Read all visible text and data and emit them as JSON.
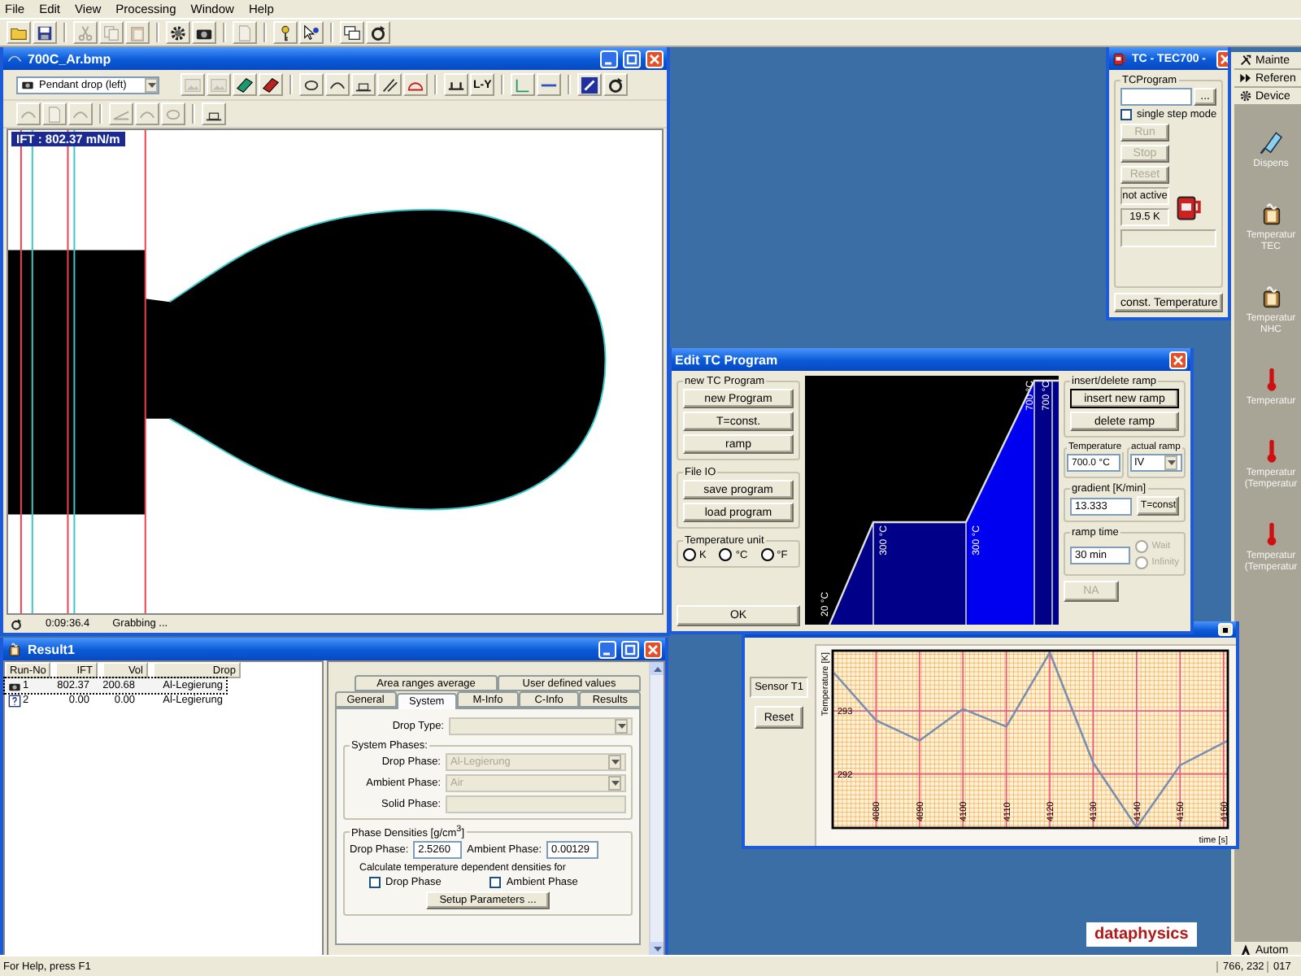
{
  "menu": [
    "File",
    "Edit",
    "View",
    "Processing",
    "Window",
    "Help"
  ],
  "toolbar": [
    {
      "kind": "open",
      "disabled": false
    },
    {
      "kind": "save",
      "disabled": false
    },
    {
      "kind": "cut",
      "disabled": true
    },
    {
      "kind": "copy",
      "disabled": true
    },
    {
      "kind": "paste",
      "disabled": true
    },
    {
      "kind": "gear",
      "disabled": false
    },
    {
      "kind": "camera",
      "disabled": false
    },
    {
      "kind": "document",
      "disabled": true
    },
    {
      "kind": "help",
      "disabled": false
    },
    {
      "kind": "context_help",
      "disabled": false
    },
    {
      "kind": "windows",
      "disabled": false
    },
    {
      "kind": "refresh",
      "disabled": false
    }
  ],
  "drop_window": {
    "title": "700C_Ar.bmp",
    "mode": "Pendant drop (left)",
    "tools_row_1": [
      {
        "kind": "image",
        "disabled": true
      },
      {
        "kind": "image",
        "disabled": true
      },
      {
        "kind": "film_green",
        "disabled": false
      },
      {
        "kind": "film_red",
        "disabled": false
      },
      {
        "kind": "ellipse",
        "disabled": false
      },
      {
        "kind": "arc",
        "disabled": false
      },
      {
        "kind": "baseline",
        "disabled": false
      },
      {
        "kind": "needle",
        "disabled": false
      },
      {
        "kind": "protractor",
        "disabled": false
      },
      {
        "kind": "bracket",
        "disabled": false
      },
      {
        "kind": "text",
        "label": "L-Y",
        "disabled": false
      },
      {
        "kind": "corner",
        "disabled": false
      },
      {
        "kind": "line",
        "disabled": false
      },
      {
        "kind": "pen",
        "disabled": false
      },
      {
        "kind": "refresh",
        "disabled": false
      }
    ],
    "tools_row_2": [
      {
        "kind": "arc",
        "disabled": true
      },
      {
        "kind": "document",
        "disabled": true
      },
      {
        "kind": "arc",
        "disabled": true
      },
      {
        "kind": "tilt",
        "disabled": true
      },
      {
        "kind": "arc",
        "disabled": true
      },
      {
        "kind": "ellipse",
        "disabled": true
      },
      {
        "kind": "baseline",
        "disabled": false
      }
    ],
    "measurement": "IFT : 802.37 mN/m",
    "elapsed": "0:09:36.4",
    "state": "Grabbing ..."
  },
  "result_window": {
    "title": "Result1",
    "columns": [
      "Run-No",
      "IFT",
      "Vol",
      "Drop"
    ],
    "rows": [
      {
        "kind": "camera",
        "run": "1",
        "ift": "802.37",
        "vol": "200.68",
        "drop": "Al-Legierung",
        "selected": true
      },
      {
        "kind": "unknown",
        "run": "2",
        "ift": "0.00",
        "vol": "0.00",
        "drop": "Al-Legierung",
        "selected": false
      }
    ],
    "tabs_row_1": [
      {
        "label": "Area ranges average",
        "selected": false
      },
      {
        "label": "User defined values",
        "selected": false
      }
    ],
    "tabs_row_2": [
      {
        "label": "General",
        "selected": false
      },
      {
        "label": "System",
        "selected": true
      },
      {
        "label": "M-Info",
        "selected": false
      },
      {
        "label": "C-Info",
        "selected": false
      },
      {
        "label": "Results",
        "selected": false
      }
    ],
    "drop_type": {
      "label": "Drop Type:"
    },
    "system_phases": {
      "title": "System Phases:",
      "fields": [
        {
          "kind": "select",
          "label": "Drop Phase:",
          "value": "Al-Legierung"
        },
        {
          "kind": "select",
          "label": "Ambient Phase:",
          "value": "Air"
        },
        {
          "kind": "text",
          "label": "Solid Phase:"
        }
      ]
    },
    "densities": {
      "title": "Phase Densities [g/cm$^{3}$]",
      "drop_label": "Drop Phase:",
      "drop_value": "2.5260",
      "ambient_label": "Ambient Phase:",
      "ambient_value": "0.00129",
      "note": "Calculate temperature dependent densities for",
      "checks": [
        {
          "label": "Drop Phase",
          "checked": false
        },
        {
          "label": "Ambient Phase",
          "checked": false
        }
      ],
      "setup": "Setup Parameters ..."
    }
  },
  "tc_window": {
    "title": "TC - TEC700 -",
    "group": "TCProgram",
    "browse": "...",
    "single_step": {
      "label": "single step mode",
      "checked": false
    },
    "buttons": [
      {
        "label": "Run",
        "disabled": true
      },
      {
        "label": "Stop",
        "disabled": true
      },
      {
        "label": "Reset",
        "disabled": true
      }
    ],
    "status": "not active",
    "reading": "19.5 K",
    "mode": "const. Temperature"
  },
  "edit_tc_window": {
    "title": "Edit TC Program",
    "new_group": {
      "title": "new TC Program",
      "buttons": [
        "new Program",
        "T=const.",
        "ramp"
      ]
    },
    "file_group": {
      "title": "File IO",
      "buttons": [
        "save program",
        "load program"
      ]
    },
    "unit_group": {
      "title": "Temperature unit",
      "options": [
        {
          "label": "K",
          "selected": false
        },
        {
          "label": "°C",
          "selected": false
        },
        {
          "label": "°F",
          "selected": false
        }
      ]
    },
    "ok": "OK",
    "profile_labels": [
      "20 °C",
      "300 °C",
      "300 °C",
      "700 °C",
      "700 °C"
    ],
    "ramp_group": {
      "title": "insert/delete ramp",
      "buttons": [
        "insert new ramp",
        "delete ramp"
      ]
    },
    "temperature": {
      "label": "Temperature",
      "value": "700.0 °C"
    },
    "actual_ramp": {
      "label": "actual ramp",
      "value": "IV"
    },
    "gradient": {
      "label": "gradient [K/min]",
      "value": "13.333",
      "button": "T=const"
    },
    "ramp_time": {
      "label": "ramp time",
      "value": "30 min",
      "options": [
        {
          "label": "Wait",
          "selected": false,
          "disabled": true
        },
        {
          "label": "Infinity",
          "selected": false,
          "disabled": true
        }
      ]
    },
    "na": "NA"
  },
  "sensor_window": {
    "sensor": "Sensor T1",
    "reset": "Reset",
    "chart_data": {
      "type": "line",
      "xlabel": "time [s]",
      "ylabel": "Temperature [K]",
      "x": [
        4070.3,
        4080,
        4090,
        4100,
        4110,
        4120,
        4130,
        4140,
        4150,
        4161
      ],
      "series": [
        {
          "color": "#7890b0",
          "values": [
            293.6,
            292.85,
            292.53,
            293.03,
            292.75,
            293.92,
            292.18,
            291.16,
            292.14,
            292.53
          ]
        }
      ],
      "grid": true,
      "xlim": [
        4070,
        4161
      ],
      "ylim": [
        291.15,
        293.95
      ],
      "xticks": [
        4080,
        4090,
        4100,
        4110,
        4120,
        4130,
        4140,
        4150,
        4160
      ],
      "yticks": [
        292,
        293
      ]
    }
  },
  "device_panel": {
    "menu": [
      {
        "kind": "tools",
        "label": "Mainte"
      },
      {
        "kind": "forward",
        "label": "Referen"
      },
      {
        "kind": "gear",
        "label": "Device"
      }
    ],
    "devices": [
      {
        "kind": "syringe",
        "label": "Dispens"
      },
      {
        "kind": "cup",
        "label": "Temperatur\nTEC"
      },
      {
        "kind": "cup",
        "label": "Temperatur\nNHC"
      },
      {
        "kind": "thermometer",
        "label": "Temperatur"
      },
      {
        "kind": "thermometer",
        "label": "Temperatur\n(Temperatur"
      },
      {
        "kind": "thermometer",
        "label": "Temperatur\n(Temperatur"
      }
    ],
    "footer": "Autom"
  },
  "logo": "dataphysics",
  "status_bar": {
    "help": "For Help, press F1",
    "position": "766, 232",
    "code": "017"
  }
}
